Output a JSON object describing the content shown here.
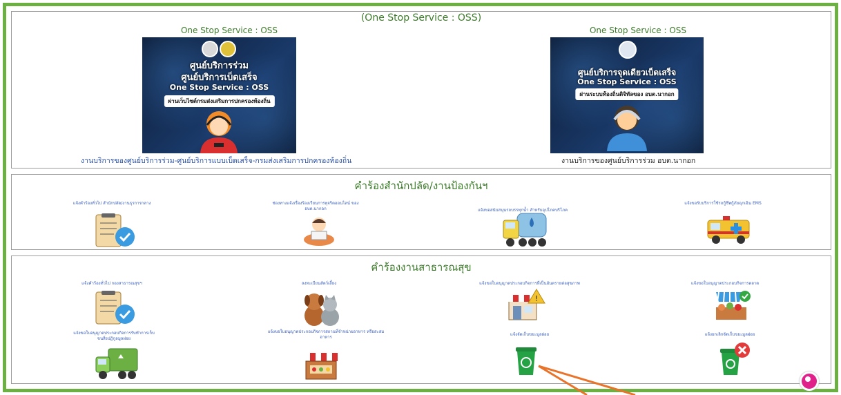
{
  "header": {
    "title": "(One Stop Service : OSS)"
  },
  "oss": [
    {
      "heading": "One Stop Service : OSS",
      "banner_line1": "ศูนย์บริการร่วม",
      "banner_line2": "ศูนย์บริการเบ็ดเสร็จ",
      "banner_line3": "One Stop Service : OSS",
      "banner_pill": "ผ่านเว็บไซต์กรมส่งเสริมการปกครองท้องถิ่น",
      "caption": "งานบริการของศูนย์บริการร่วม-ศูนย์บริการแบบเบ็ดเสร็จ-กรมส่งเสริมการปกครองท้องถิ่น"
    },
    {
      "heading": "One Stop Service : OSS",
      "banner_line1": "ศูนย์บริการจุดเดียวเบ็ดเสร็จ",
      "banner_line2": "One Stop Service : OSS",
      "banner_pill": "ผ่านระบบท้องถิ่นดิจิทัลของ อบต.นากอก",
      "caption": "งานบริการของศูนย์บริการร่วม อบต.นากอก"
    }
  ],
  "section1": {
    "title": "คำร้องสำนักปลัด/งานป้องกันฯ",
    "items": [
      {
        "label": "แจ้งคำร้องทั่วไป สำนักปลัด/งานธุรการกลาง",
        "icon": "clipboard-check-icon"
      },
      {
        "label": "ช่องทางแจ้งเรื่องร้องเรียนการทุจริตออนไลน์ ของ อบต.นากอก",
        "icon": "complaint-person-icon"
      },
      {
        "label": "แจ้งขอสนับสนุนรถบรรทุกน้ำ สำหรับอุปโภคบริโภค",
        "icon": "water-truck-icon"
      },
      {
        "label": "แจ้งขอรับบริการใช้รถกู้ชีพกู้ภัยฉุกเฉิน EMS",
        "icon": "ambulance-icon"
      }
    ]
  },
  "section2": {
    "title": "คำร้องงานสาธารณสุข",
    "items": [
      {
        "label": "แจ้งคำร้องทั่วไป กองสาธารณสุขฯ",
        "icon": "clipboard-check-icon"
      },
      {
        "label": "ลงทะเบียนสัตว์เลี้ยง",
        "icon": "pets-icon"
      },
      {
        "label": "แจ้งขอใบอนุญาตประกอบกิจการที่เป็นอันตรายต่อสุขภาพ",
        "icon": "shop-warning-icon"
      },
      {
        "label": "แจ้งขอใบอนุญาตประกอบกิจการตลาด",
        "icon": "market-icon"
      },
      {
        "label": "แจ้งขอใบอนุญาตประกอบกิจการรับทำการเก็บ ขนสิ่งปฏิกูลมูลฝอย",
        "icon": "garbage-truck-icon"
      },
      {
        "label": "แจ้งขอใบอนุญาตประกอบกิจการสถานที่จำหน่ายอาหาร หรือสะสมอาหาร",
        "icon": "food-shop-icon"
      },
      {
        "label": "แจ้งจัดเก็บขยะมูลฝอย",
        "icon": "recycle-bin-icon"
      },
      {
        "label": "แจ้งยกเลิกจัดเก็บขยะมูลฝอย",
        "icon": "bin-cancel-icon"
      }
    ]
  },
  "colors": {
    "frame": "#6cb043",
    "title_green": "#3c7b2a",
    "link_blue": "#2a4fa3",
    "arrow": "#e8732a"
  },
  "widget": {
    "icon": "chat-bubble-icon"
  }
}
